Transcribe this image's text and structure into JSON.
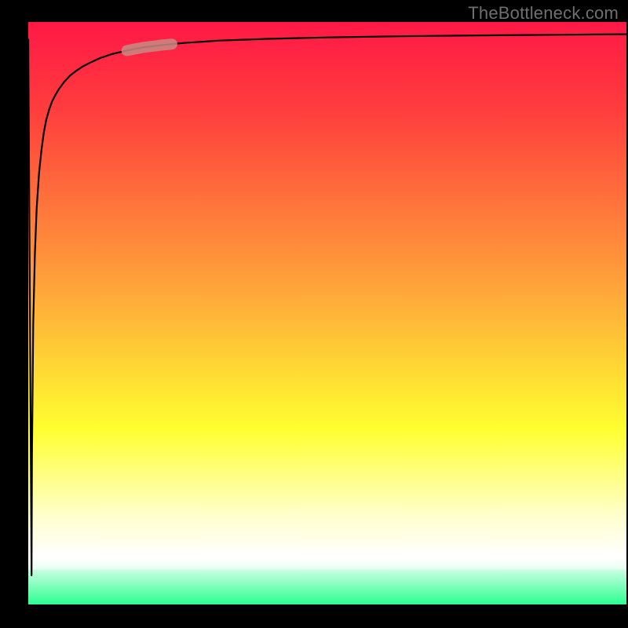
{
  "watermark": "TheBottleneck.com",
  "colors": {
    "top_red": "#ff1846",
    "mid_red": "#ff3d3d",
    "orange": "#ffa23a",
    "yellow": "#ffff30",
    "pale_yellow": "#ffffcf",
    "green": "#2cff8f",
    "frame_black": "#000000",
    "curve": "#000000",
    "highlight": "#c88b83",
    "white": "#ffffff"
  },
  "chart_data": {
    "type": "line",
    "title": "",
    "xlabel": "",
    "ylabel": "",
    "xlim": [
      0,
      100
    ],
    "ylim": [
      0,
      100
    ],
    "series": [
      {
        "name": "bottleneck-curve",
        "x": [
          0.0,
          0.55,
          0.62,
          0.83,
          1.1,
          1.4,
          1.8,
          2.2,
          2.6,
          3.0,
          3.5,
          4.0,
          4.6,
          5.2,
          6.0,
          7.0,
          8.0,
          9.0,
          10.5,
          12.0,
          14.0,
          16.5,
          19.0,
          22.0,
          26.0,
          32.0,
          40.0,
          50.0,
          62.0,
          75.0,
          88.0,
          100.0
        ],
        "y": [
          97.0,
          5.0,
          25.0,
          48.0,
          60.0,
          68.0,
          74.0,
          78.0,
          81.0,
          83.2,
          85.0,
          86.4,
          87.6,
          88.6,
          89.7,
          90.8,
          91.6,
          92.3,
          93.1,
          93.8,
          94.5,
          95.1,
          95.6,
          96.0,
          96.4,
          96.8,
          97.1,
          97.35,
          97.55,
          97.7,
          97.8,
          97.9
        ]
      }
    ],
    "highlight_segment": {
      "x_start": 16.5,
      "x_end": 24.0
    },
    "gradient_stops": [
      {
        "pct": 0,
        "color": "#ff1846"
      },
      {
        "pct": 15,
        "color": "#ff3d3d"
      },
      {
        "pct": 45,
        "color": "#ffa23a"
      },
      {
        "pct": 70,
        "color": "#ffff30"
      },
      {
        "pct": 85,
        "color": "#ffffcf"
      },
      {
        "pct": 92,
        "color": "#ffffff"
      },
      {
        "pct": 100,
        "color": "#2cff8f"
      }
    ]
  }
}
